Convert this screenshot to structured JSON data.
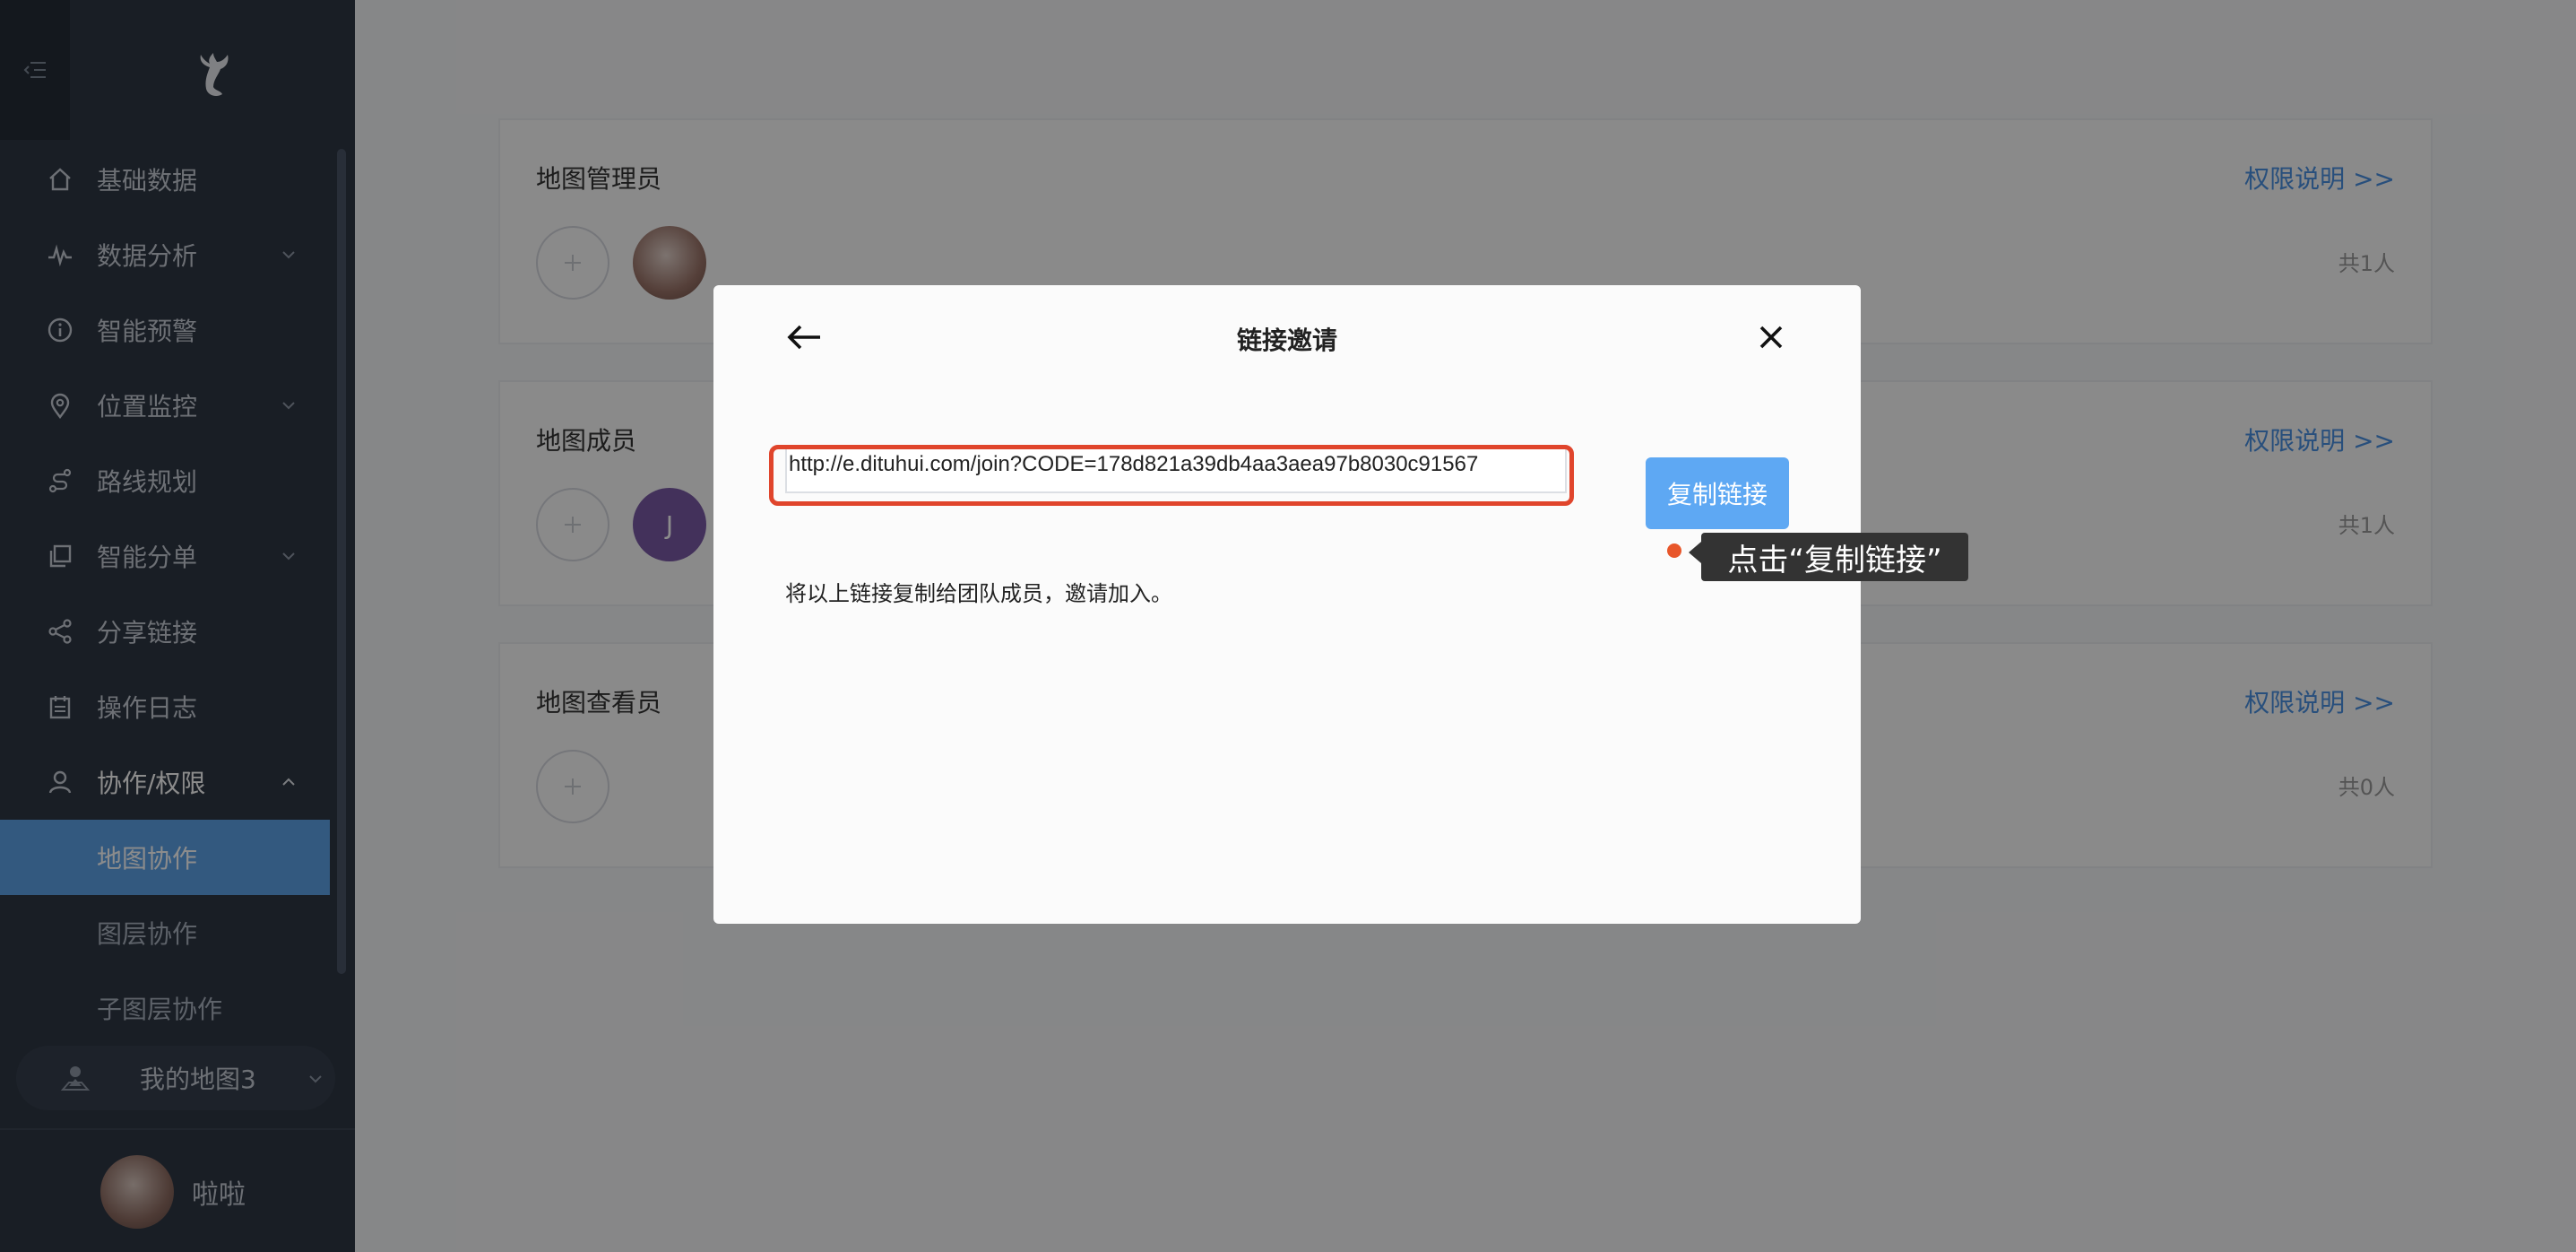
{
  "sidebar": {
    "items": [
      {
        "label": "基础数据",
        "icon": "home-icon"
      },
      {
        "label": "数据分析",
        "icon": "pulse-icon",
        "has_arrow": true
      },
      {
        "label": "智能预警",
        "icon": "info-icon"
      },
      {
        "label": "位置监控",
        "icon": "location-pin-icon",
        "has_arrow": true
      },
      {
        "label": "路线规划",
        "icon": "route-icon"
      },
      {
        "label": "智能分单",
        "icon": "copy-icon",
        "has_arrow": true
      },
      {
        "label": "分享链接",
        "icon": "share-icon"
      },
      {
        "label": "操作日志",
        "icon": "calendar-icon"
      },
      {
        "label": "协作/权限",
        "icon": "user-icon",
        "has_arrow": true,
        "open": true
      }
    ],
    "sub_items": [
      {
        "label": "地图协作",
        "active": true
      },
      {
        "label": "图层协作"
      },
      {
        "label": "子图层协作"
      }
    ],
    "my_map": "我的地图3",
    "user_name": "啦啦"
  },
  "cards": [
    {
      "title": "地图管理员",
      "link": "权限说明 >>",
      "count": "共1人"
    },
    {
      "title": "地图成员",
      "link": "权限说明 >>",
      "count": "共1人",
      "member_letter": "J"
    },
    {
      "title": "地图查看员",
      "link": "权限说明 >>",
      "count": "共0人"
    }
  ],
  "modal": {
    "title": "链接邀请",
    "link": "http://e.dituhui.com/join?CODE=178d821a39db4aa3aea97b8030c91567",
    "copy_label": "复制链接",
    "hint": "将以上链接复制给团队成员，邀请加入。",
    "tooltip": "点击“复制链接”"
  },
  "colors": {
    "accent": "#5ea8f3",
    "highlight": "#e0452c",
    "sidebar_bg": "#2f3744"
  }
}
